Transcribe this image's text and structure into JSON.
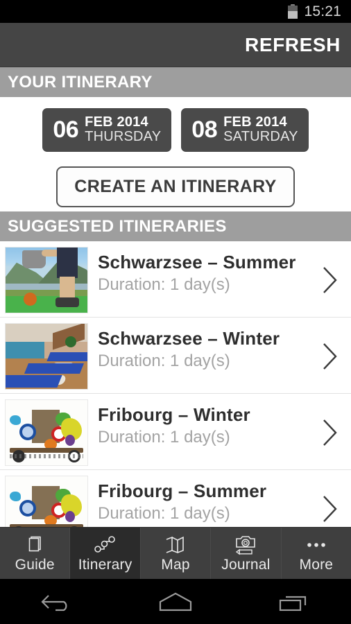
{
  "statusbar": {
    "time": "15:21",
    "battery_icon": "battery-icon"
  },
  "actionbar": {
    "refresh_label": "REFRESH"
  },
  "your_itinerary": {
    "header": "YOUR ITINERARY",
    "dates": [
      {
        "day": "06",
        "month_year": "FEB 2014",
        "weekday": "THURSDAY"
      },
      {
        "day": "08",
        "month_year": "FEB 2014",
        "weekday": "SATURDAY"
      }
    ],
    "create_button": "CREATE AN ITINERARY"
  },
  "suggested": {
    "header": "SUGGESTED ITINERARIES",
    "items": [
      {
        "title": "Schwarzsee – Summer",
        "duration": "Duration: 1 day(s)",
        "thumb": "summer-lake-lawn-photo",
        "chevron": "chevron-right-icon"
      },
      {
        "title": "Schwarzsee – Winter",
        "duration": "Duration: 1 day(s)",
        "thumb": "indoor-pool-loungers-photo",
        "chevron": "chevron-right-icon"
      },
      {
        "title": "Fribourg – Winter",
        "duration": "Duration: 1 day(s)",
        "thumb": "colorful-artwork-sketch-photo",
        "chevron": "chevron-right-icon"
      },
      {
        "title": "Fribourg – Summer",
        "duration": "Duration: 1 day(s)",
        "thumb": "colorful-artwork-sketch-photo",
        "chevron": "chevron-right-icon"
      }
    ]
  },
  "tabbar": {
    "active": "Itinerary",
    "tabs": [
      {
        "label": "Guide",
        "icon": "book-icon"
      },
      {
        "label": "Itinerary",
        "icon": "route-nodes-icon"
      },
      {
        "label": "Map",
        "icon": "folded-map-icon"
      },
      {
        "label": "Journal",
        "icon": "camera-pencil-icon"
      },
      {
        "label": "More",
        "icon": "ellipsis-icon"
      }
    ]
  },
  "navbar": {
    "back": "back-icon",
    "home": "home-icon",
    "recents": "recents-icon"
  },
  "colors": {
    "status_bg": "#000000",
    "actionbar_bg": "#454545",
    "section_header_bg": "#9e9e9e",
    "chip_bg": "#4a4a4a",
    "tabbar_bg": "#3f3f3f",
    "tab_active_bg": "#2b2b2b",
    "title_text": "#2e2e2e",
    "subtitle_text": "#a3a3a3"
  }
}
